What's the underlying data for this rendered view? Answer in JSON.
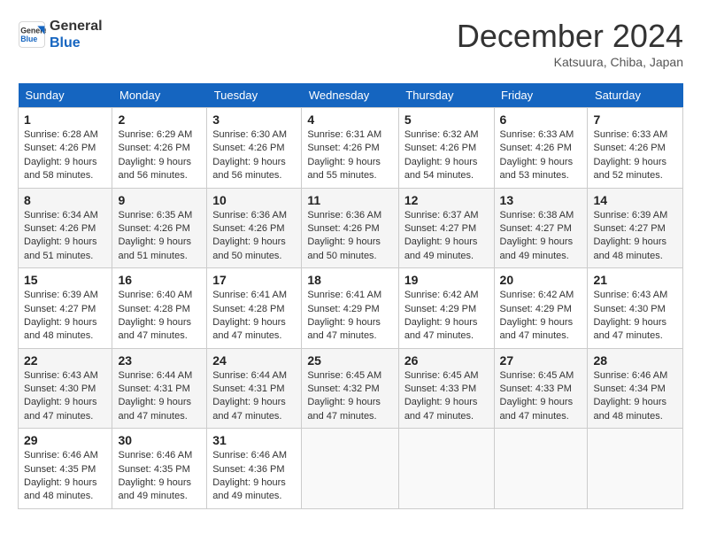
{
  "header": {
    "logo_line1": "General",
    "logo_line2": "Blue",
    "month": "December 2024",
    "location": "Katsuura, Chiba, Japan"
  },
  "days_of_week": [
    "Sunday",
    "Monday",
    "Tuesday",
    "Wednesday",
    "Thursday",
    "Friday",
    "Saturday"
  ],
  "weeks": [
    [
      {
        "day": 1,
        "sunrise": "6:28 AM",
        "sunset": "4:26 PM",
        "daylight": "9 hours and 58 minutes."
      },
      {
        "day": 2,
        "sunrise": "6:29 AM",
        "sunset": "4:26 PM",
        "daylight": "9 hours and 56 minutes."
      },
      {
        "day": 3,
        "sunrise": "6:30 AM",
        "sunset": "4:26 PM",
        "daylight": "9 hours and 56 minutes."
      },
      {
        "day": 4,
        "sunrise": "6:31 AM",
        "sunset": "4:26 PM",
        "daylight": "9 hours and 55 minutes."
      },
      {
        "day": 5,
        "sunrise": "6:32 AM",
        "sunset": "4:26 PM",
        "daylight": "9 hours and 54 minutes."
      },
      {
        "day": 6,
        "sunrise": "6:33 AM",
        "sunset": "4:26 PM",
        "daylight": "9 hours and 53 minutes."
      },
      {
        "day": 7,
        "sunrise": "6:33 AM",
        "sunset": "4:26 PM",
        "daylight": "9 hours and 52 minutes."
      }
    ],
    [
      {
        "day": 8,
        "sunrise": "6:34 AM",
        "sunset": "4:26 PM",
        "daylight": "9 hours and 51 minutes."
      },
      {
        "day": 9,
        "sunrise": "6:35 AM",
        "sunset": "4:26 PM",
        "daylight": "9 hours and 51 minutes."
      },
      {
        "day": 10,
        "sunrise": "6:36 AM",
        "sunset": "4:26 PM",
        "daylight": "9 hours and 50 minutes."
      },
      {
        "day": 11,
        "sunrise": "6:36 AM",
        "sunset": "4:26 PM",
        "daylight": "9 hours and 50 minutes."
      },
      {
        "day": 12,
        "sunrise": "6:37 AM",
        "sunset": "4:27 PM",
        "daylight": "9 hours and 49 minutes."
      },
      {
        "day": 13,
        "sunrise": "6:38 AM",
        "sunset": "4:27 PM",
        "daylight": "9 hours and 49 minutes."
      },
      {
        "day": 14,
        "sunrise": "6:39 AM",
        "sunset": "4:27 PM",
        "daylight": "9 hours and 48 minutes."
      }
    ],
    [
      {
        "day": 15,
        "sunrise": "6:39 AM",
        "sunset": "4:27 PM",
        "daylight": "9 hours and 48 minutes."
      },
      {
        "day": 16,
        "sunrise": "6:40 AM",
        "sunset": "4:28 PM",
        "daylight": "9 hours and 47 minutes."
      },
      {
        "day": 17,
        "sunrise": "6:41 AM",
        "sunset": "4:28 PM",
        "daylight": "9 hours and 47 minutes."
      },
      {
        "day": 18,
        "sunrise": "6:41 AM",
        "sunset": "4:29 PM",
        "daylight": "9 hours and 47 minutes."
      },
      {
        "day": 19,
        "sunrise": "6:42 AM",
        "sunset": "4:29 PM",
        "daylight": "9 hours and 47 minutes."
      },
      {
        "day": 20,
        "sunrise": "6:42 AM",
        "sunset": "4:29 PM",
        "daylight": "9 hours and 47 minutes."
      },
      {
        "day": 21,
        "sunrise": "6:43 AM",
        "sunset": "4:30 PM",
        "daylight": "9 hours and 47 minutes."
      }
    ],
    [
      {
        "day": 22,
        "sunrise": "6:43 AM",
        "sunset": "4:30 PM",
        "daylight": "9 hours and 47 minutes."
      },
      {
        "day": 23,
        "sunrise": "6:44 AM",
        "sunset": "4:31 PM",
        "daylight": "9 hours and 47 minutes."
      },
      {
        "day": 24,
        "sunrise": "6:44 AM",
        "sunset": "4:31 PM",
        "daylight": "9 hours and 47 minutes."
      },
      {
        "day": 25,
        "sunrise": "6:45 AM",
        "sunset": "4:32 PM",
        "daylight": "9 hours and 47 minutes."
      },
      {
        "day": 26,
        "sunrise": "6:45 AM",
        "sunset": "4:33 PM",
        "daylight": "9 hours and 47 minutes."
      },
      {
        "day": 27,
        "sunrise": "6:45 AM",
        "sunset": "4:33 PM",
        "daylight": "9 hours and 47 minutes."
      },
      {
        "day": 28,
        "sunrise": "6:46 AM",
        "sunset": "4:34 PM",
        "daylight": "9 hours and 48 minutes."
      }
    ],
    [
      {
        "day": 29,
        "sunrise": "6:46 AM",
        "sunset": "4:35 PM",
        "daylight": "9 hours and 48 minutes."
      },
      {
        "day": 30,
        "sunrise": "6:46 AM",
        "sunset": "4:35 PM",
        "daylight": "9 hours and 49 minutes."
      },
      {
        "day": 31,
        "sunrise": "6:46 AM",
        "sunset": "4:36 PM",
        "daylight": "9 hours and 49 minutes."
      },
      null,
      null,
      null,
      null
    ]
  ],
  "labels": {
    "sunrise": "Sunrise:",
    "sunset": "Sunset:",
    "daylight": "Daylight:"
  }
}
